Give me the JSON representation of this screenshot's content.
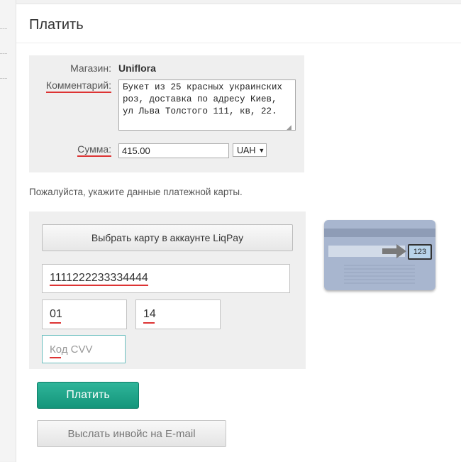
{
  "page": {
    "title": "Платить"
  },
  "order": {
    "shop_label": "Магазин:",
    "shop_value": "Uniflora",
    "comment_label": "Комментарий:",
    "comment_value": "Букет из 25 красных украинских роз, доставка по адресу Киев, ул Льва Толстого 111, кв, 22.",
    "sum_label": "Сумма:",
    "sum_value": "415.00",
    "currency": "UAH"
  },
  "prompt": "Пожалуйста, укажите данные платежной карты.",
  "card_form": {
    "liqpay_button": "Выбрать карту в аккаунте LiqPay",
    "card_number": "1111222233334444",
    "exp_month": "01",
    "exp_year": "14",
    "cvv_placeholder": "Код CVV",
    "card_hint_cvv": "123"
  },
  "actions": {
    "pay_button": "Платить",
    "invoice_button": "Выслать инвойс на E-mail"
  },
  "colors": {
    "pay_accent": "#1aa487",
    "error_underline": "#dd3333"
  }
}
